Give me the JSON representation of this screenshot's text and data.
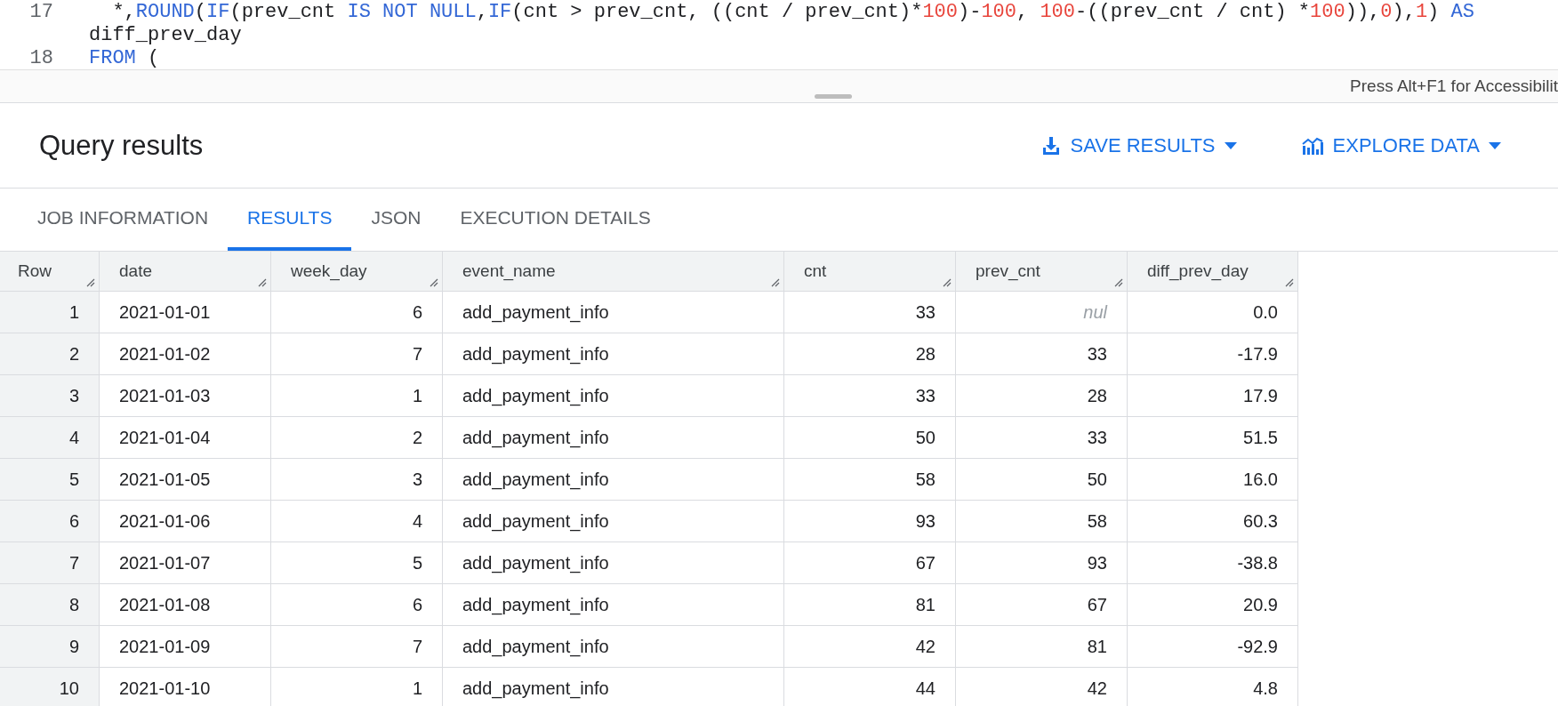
{
  "editor": {
    "lines": [
      {
        "number": "17",
        "tokens": [
          {
            "text": "  *,",
            "kind": "plain"
          },
          {
            "text": "ROUND",
            "kind": "keyword"
          },
          {
            "text": "(",
            "kind": "plain"
          },
          {
            "text": "IF",
            "kind": "keyword"
          },
          {
            "text": "(prev_cnt ",
            "kind": "plain"
          },
          {
            "text": "IS NOT NULL",
            "kind": "keyword"
          },
          {
            "text": ",",
            "kind": "plain"
          },
          {
            "text": "IF",
            "kind": "keyword"
          },
          {
            "text": "(cnt > prev_cnt, ((cnt / prev_cnt)*",
            "kind": "plain"
          },
          {
            "text": "100",
            "kind": "number"
          },
          {
            "text": ")-",
            "kind": "plain"
          },
          {
            "text": "100",
            "kind": "number"
          },
          {
            "text": ", ",
            "kind": "plain"
          },
          {
            "text": "100",
            "kind": "number"
          },
          {
            "text": "-((prev_cnt / cnt) *",
            "kind": "plain"
          },
          {
            "text": "100",
            "kind": "number"
          },
          {
            "text": ")),",
            "kind": "plain"
          },
          {
            "text": "0",
            "kind": "number"
          },
          {
            "text": "),",
            "kind": "plain"
          },
          {
            "text": "1",
            "kind": "number"
          },
          {
            "text": ") ",
            "kind": "plain"
          },
          {
            "text": "AS",
            "kind": "keyword"
          }
        ]
      },
      {
        "tokens": [
          {
            "text": "diff_prev_day",
            "kind": "plain"
          }
        ]
      },
      {
        "number": "18",
        "tokens": [
          {
            "text": "FROM",
            "kind": "keyword"
          },
          {
            "text": " (",
            "kind": "plain"
          }
        ]
      }
    ]
  },
  "status_bar": {
    "hint": "Press Alt+F1 for Accessibilit"
  },
  "results": {
    "title": "Query results",
    "actions": [
      {
        "label": "SAVE RESULTS",
        "kind": "save"
      },
      {
        "label": "EXPLORE DATA",
        "kind": "explore"
      }
    ]
  },
  "tabs": [
    {
      "label": "JOB INFORMATION",
      "selected": false
    },
    {
      "label": "RESULTS",
      "selected": true
    },
    {
      "label": "JSON",
      "selected": false
    },
    {
      "label": "EXECUTION DETAILS",
      "selected": false
    }
  ],
  "table": {
    "columns": [
      {
        "label": "Row",
        "kind": "number"
      },
      {
        "label": "date",
        "kind": "text"
      },
      {
        "label": "week_day",
        "kind": "number"
      },
      {
        "label": "event_name",
        "kind": "text"
      },
      {
        "label": "cnt",
        "kind": "number"
      },
      {
        "label": "prev_cnt",
        "kind": "number"
      },
      {
        "label": "diff_prev_day",
        "kind": "number"
      }
    ],
    "rows": [
      [
        "1",
        "2021-01-01",
        "6",
        "add_payment_info",
        "33",
        {
          "text": "nul",
          "kind": "null"
        },
        "0.0"
      ],
      [
        "2",
        "2021-01-02",
        "7",
        "add_payment_info",
        "28",
        "33",
        "-17.9"
      ],
      [
        "3",
        "2021-01-03",
        "1",
        "add_payment_info",
        "33",
        "28",
        "17.9"
      ],
      [
        "4",
        "2021-01-04",
        "2",
        "add_payment_info",
        "50",
        "33",
        "51.5"
      ],
      [
        "5",
        "2021-01-05",
        "3",
        "add_payment_info",
        "58",
        "50",
        "16.0"
      ],
      [
        "6",
        "2021-01-06",
        "4",
        "add_payment_info",
        "93",
        "58",
        "60.3"
      ],
      [
        "7",
        "2021-01-07",
        "5",
        "add_payment_info",
        "67",
        "93",
        "-38.8"
      ],
      [
        "8",
        "2021-01-08",
        "6",
        "add_payment_info",
        "81",
        "67",
        "20.9"
      ],
      [
        "9",
        "2021-01-09",
        "7",
        "add_payment_info",
        "42",
        "81",
        "-92.9"
      ],
      [
        "10",
        "2021-01-10",
        "1",
        "add_payment_info",
        "44",
        "42",
        "4.8"
      ]
    ]
  }
}
